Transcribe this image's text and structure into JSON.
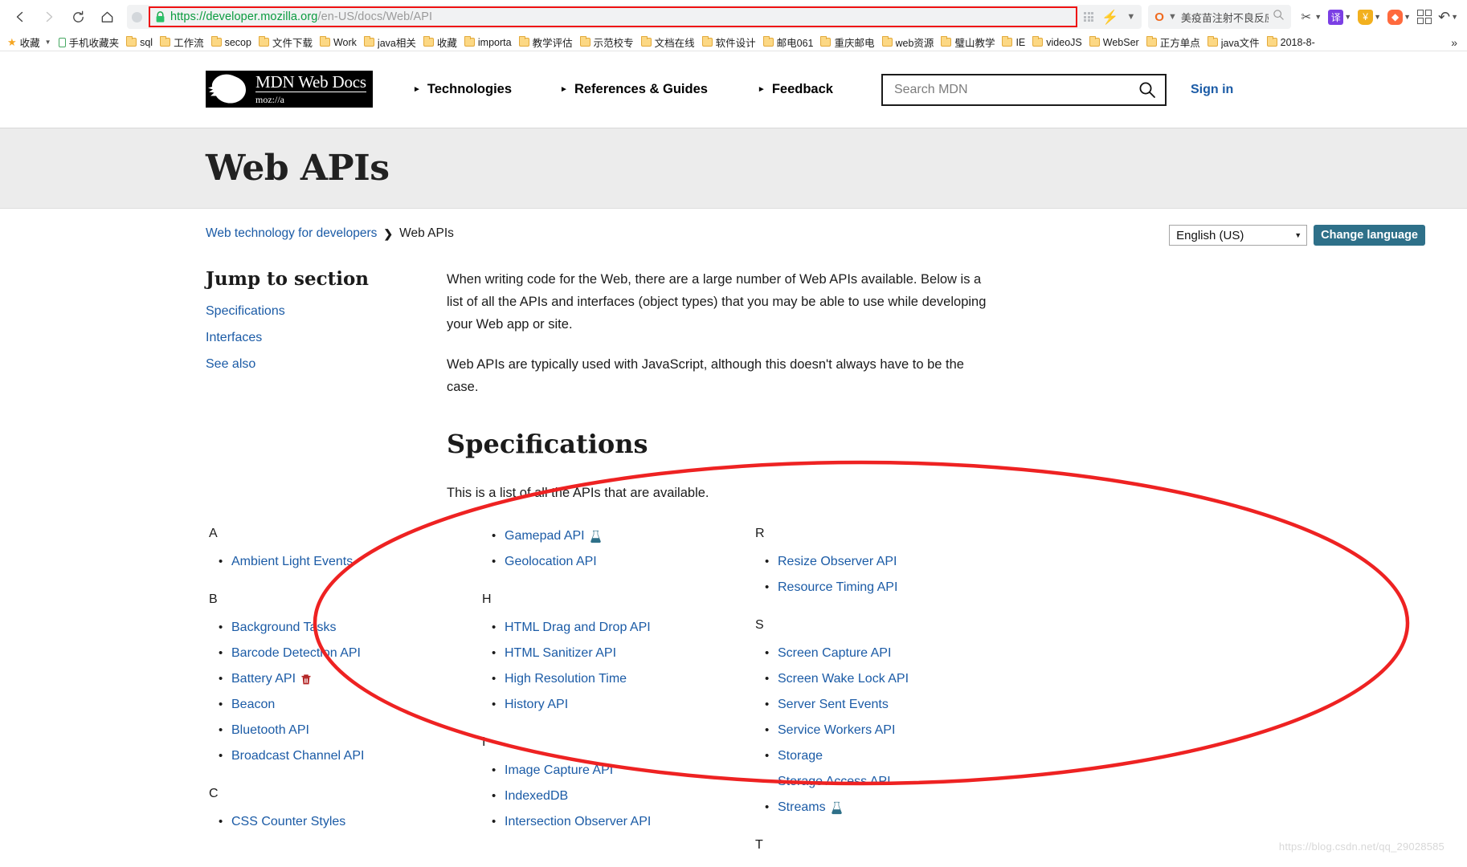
{
  "browser": {
    "back_icon": "back-arrow-icon",
    "forward_icon": "forward-arrow-icon",
    "reload_icon": "reload-icon",
    "home_icon": "home-icon",
    "url_host": "https://developer.mozilla.org",
    "url_path": "/en-US/docs/Web/API",
    "url_full": "https://developer.mozilla.org/en-US/docs/Web/API",
    "url_highlight_color": "#ee1111",
    "omnibox_search_logo": "O",
    "omnibox_search_query": "美疫苗注射不良反应",
    "extensions": [
      {
        "name": "scissors-capture-icon",
        "glyph": "✂",
        "color": "#4a4a4a",
        "bg": "transparent"
      },
      {
        "name": "translate-icon",
        "glyph": "译",
        "color": "#ffffff",
        "bg": "#7b3fe4"
      },
      {
        "name": "shield-badge-icon",
        "glyph": "¥",
        "color": "#ffffff",
        "bg": "#f2b01e"
      },
      {
        "name": "game-controller-icon",
        "glyph": "✶",
        "color": "#ffffff",
        "bg": "#ff6a3d"
      }
    ],
    "apps_grid_icon": "apps-grid-icon",
    "undo_icon": "undo-icon"
  },
  "bookmarks": {
    "overflow_label": "»",
    "items": [
      {
        "label": "收藏",
        "icon": "star-icon",
        "caret": true
      },
      {
        "label": "手机收藏夹",
        "icon": "phone-icon"
      },
      {
        "label": "sql",
        "icon": "folder-icon"
      },
      {
        "label": "工作流",
        "icon": "folder-icon"
      },
      {
        "label": "secop",
        "icon": "folder-icon"
      },
      {
        "label": "文件下载",
        "icon": "folder-icon"
      },
      {
        "label": "Work",
        "icon": "folder-icon"
      },
      {
        "label": "java相关",
        "icon": "folder-icon"
      },
      {
        "label": "收藏",
        "icon": "folder-icon"
      },
      {
        "label": "importa",
        "icon": "folder-icon"
      },
      {
        "label": "教学评估",
        "icon": "folder-icon"
      },
      {
        "label": "示范校专",
        "icon": "folder-icon"
      },
      {
        "label": "文档在线",
        "icon": "folder-icon"
      },
      {
        "label": "软件设计",
        "icon": "folder-icon"
      },
      {
        "label": "邮电061",
        "icon": "folder-icon"
      },
      {
        "label": "重庆邮电",
        "icon": "folder-icon"
      },
      {
        "label": "web资源",
        "icon": "folder-icon"
      },
      {
        "label": "璧山教学",
        "icon": "folder-icon"
      },
      {
        "label": "IE",
        "icon": "folder-icon"
      },
      {
        "label": "videoJS",
        "icon": "folder-icon"
      },
      {
        "label": "WebSer",
        "icon": "folder-icon"
      },
      {
        "label": "正方单点",
        "icon": "folder-icon"
      },
      {
        "label": "java文件",
        "icon": "folder-icon"
      },
      {
        "label": "2018-8-",
        "icon": "folder-icon"
      }
    ]
  },
  "site": {
    "logo_title": "MDN Web Docs",
    "logo_sub": "moz://a",
    "nav": [
      {
        "label": "Technologies"
      },
      {
        "label": "References & Guides"
      },
      {
        "label": "Feedback"
      }
    ],
    "search_placeholder": "Search MDN",
    "search_value": "",
    "sign_in_label": "Sign in",
    "accent_teal": "#2e7089",
    "link_blue": "#1b5ba6"
  },
  "page": {
    "title": "Web APIs",
    "breadcrumb": {
      "parent": "Web technology for developers",
      "separator": "❯",
      "current": "Web APIs"
    },
    "language": {
      "selected": "English (US)",
      "change_button": "Change language"
    },
    "jump": {
      "heading": "Jump to section",
      "links": [
        "Specifications",
        "Interfaces",
        "See also"
      ]
    },
    "intro_paragraph_1": "When writing code for the Web, there are a large number of Web APIs available. Below is a list of all the APIs and interfaces (object types) that you may be able to use while developing your Web app or site.",
    "intro_paragraph_2": "Web APIs are typically used with JavaScript, although this doesn't always have to be the case.",
    "specifications_heading": "Specifications",
    "specifications_intro": "This is a list of all the APIs that are available.",
    "api_columns": [
      {
        "groups": [
          {
            "letter": "A",
            "items": [
              {
                "label": "Ambient Light Events"
              }
            ]
          },
          {
            "letter": "B",
            "items": [
              {
                "label": "Background Tasks"
              },
              {
                "label": "Barcode Detection API"
              },
              {
                "label": "Battery API",
                "badge": "deprecated-trash-icon"
              },
              {
                "label": "Beacon"
              },
              {
                "label": "Bluetooth API"
              },
              {
                "label": "Broadcast Channel API"
              }
            ]
          },
          {
            "letter": "C",
            "items": [
              {
                "label": "CSS Counter Styles"
              }
            ]
          }
        ]
      },
      {
        "groups": [
          {
            "letter": "",
            "items": [
              {
                "label": "Gamepad API",
                "badge": "experimental-flask-icon"
              },
              {
                "label": "Geolocation API"
              }
            ]
          },
          {
            "letter": "H",
            "items": [
              {
                "label": "HTML Drag and Drop API"
              },
              {
                "label": "HTML Sanitizer API"
              },
              {
                "label": "High Resolution Time"
              },
              {
                "label": "History API"
              }
            ]
          },
          {
            "letter": "I",
            "items": [
              {
                "label": "Image Capture API"
              },
              {
                "label": "IndexedDB"
              },
              {
                "label": "Intersection Observer API"
              }
            ]
          }
        ]
      },
      {
        "groups": [
          {
            "letter": "R",
            "items": [
              {
                "label": "Resize Observer API"
              },
              {
                "label": "Resource Timing API"
              }
            ]
          },
          {
            "letter": "S",
            "items": [
              {
                "label": "Screen Capture API"
              },
              {
                "label": "Screen Wake Lock API"
              },
              {
                "label": "Server Sent Events"
              },
              {
                "label": "Service Workers API"
              },
              {
                "label": "Storage"
              },
              {
                "label": "Storage Access API"
              },
              {
                "label": "Streams",
                "badge": "experimental-flask-icon"
              }
            ]
          },
          {
            "letter": "T",
            "items": []
          }
        ]
      }
    ],
    "annotation": {
      "type": "red-ellipse",
      "color": "#ee2222"
    },
    "watermark": "https://blog.csdn.net/qq_29028585"
  }
}
